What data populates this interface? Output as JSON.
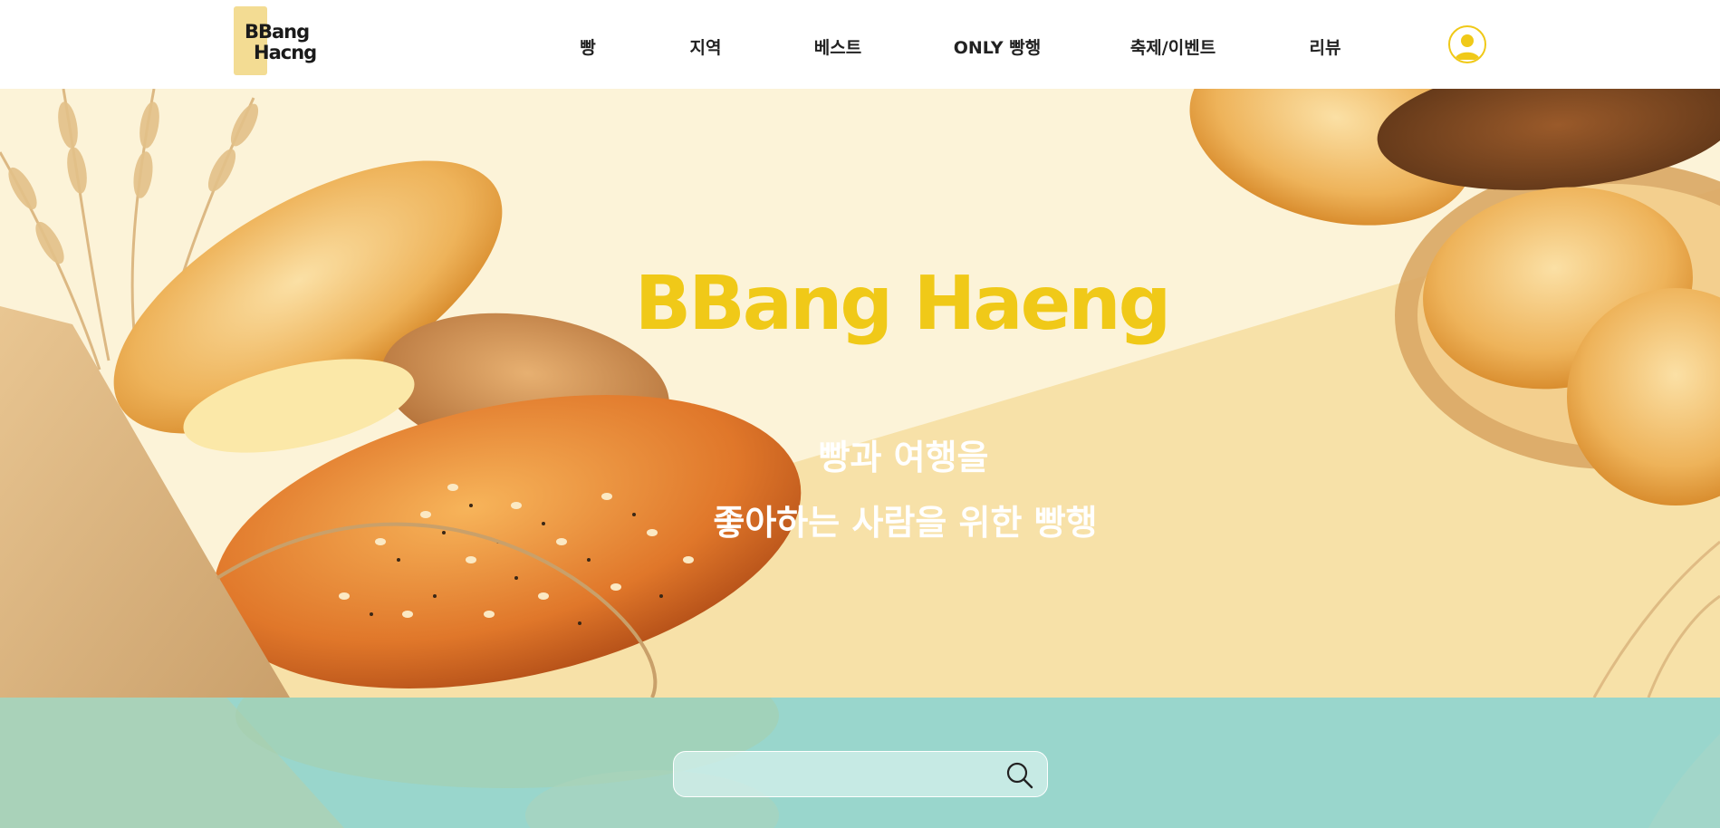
{
  "logo": {
    "line1": "BBang",
    "line2": "Hacng"
  },
  "nav": {
    "items": [
      {
        "label": "빵"
      },
      {
        "label": "지역"
      },
      {
        "label": "베스트"
      },
      {
        "label": "ONLY 빵행"
      },
      {
        "label": "축제/이벤트"
      },
      {
        "label": "리뷰"
      }
    ]
  },
  "icons": {
    "user": "user-icon",
    "search": "search-icon"
  },
  "hero": {
    "title": "BBang Haeng",
    "subtitle_line1": "빵과 여행을",
    "subtitle_line2": "좋아하는 사람을 위한 빵행"
  },
  "search": {
    "placeholder": "",
    "value": ""
  },
  "colors": {
    "brand_yellow": "#f0c918",
    "logo_square": "#f3dc93",
    "hero_bg": "#fcf3d8",
    "search_band": "#99d6cc"
  }
}
